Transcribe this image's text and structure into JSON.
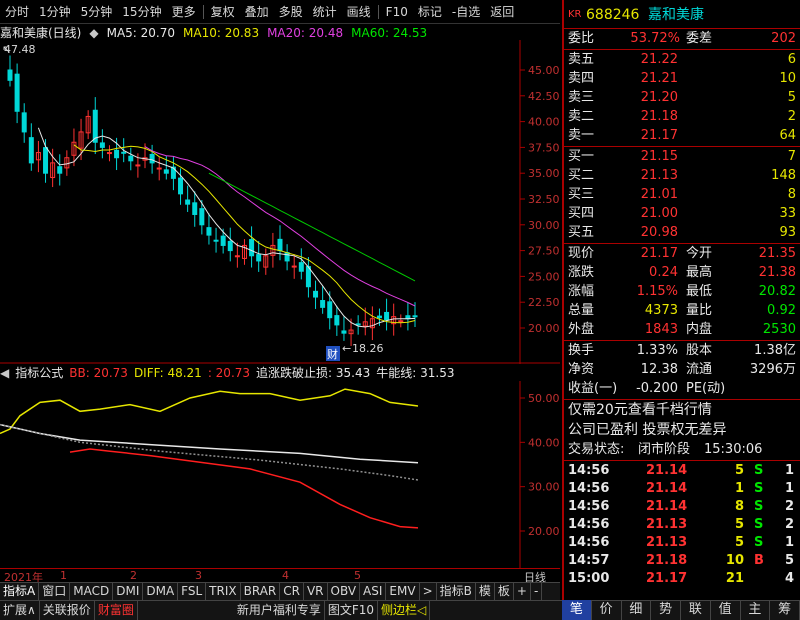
{
  "toolbar": {
    "items": [
      "分时",
      "1分钟",
      "5分钟",
      "15分钟",
      "更多",
      "复权",
      "叠加",
      "多股",
      "统计",
      "画线",
      "F10",
      "标记",
      "-自选",
      "返回"
    ]
  },
  "chart_header": {
    "stock_name": "嘉和美康(日线)",
    "ma5": "MA5: 20.70",
    "ma10": "MA10: 20.83",
    "ma20": "MA20: 20.48",
    "ma60": "MA60: 24.53",
    "high_label": "47.48",
    "low_label": "18.26",
    "cai_label": "财"
  },
  "price_axis": [
    "45.00",
    "42.50",
    "40.00",
    "37.50",
    "35.00",
    "32.50",
    "30.00",
    "27.50",
    "25.00",
    "22.50",
    "20.00"
  ],
  "indicator_header": {
    "name": "指标公式",
    "bb": "BB: 20.73",
    "diff": "DIFF: 48.21",
    "third": ": 20.73",
    "stop": "追涨跌破止损: 35.43",
    "bull": "牛能线: 31.53"
  },
  "indicator_axis": [
    "50.00",
    "40.00",
    "30.00",
    "20.00"
  ],
  "date_axis": {
    "year": "2021年",
    "months": [
      "1",
      "2",
      "3",
      "4",
      "5"
    ],
    "right_label": "日线"
  },
  "tabs": [
    "指标A",
    "窗口",
    "MACD",
    "DMI",
    "DMA",
    "FSL",
    "TRIX",
    "BRAR",
    "CR",
    "VR",
    "OBV",
    "ASI",
    "EMV",
    ">",
    "指标B",
    "模",
    "板",
    "+",
    "-"
  ],
  "bottom_bar": [
    "扩展∧",
    "关联报价",
    "财富圈",
    "新用户福利专享",
    "图文F10",
    "侧边栏◁"
  ],
  "stock": {
    "code_prefix": "KR",
    "code": "688246",
    "name": "嘉和美康"
  },
  "order_book": {
    "weibi_label": "委比",
    "weibi": "53.72%",
    "weicha_label": "委差",
    "weicha": "202",
    "asks": [
      {
        "label": "卖五",
        "price": "21.22",
        "vol": "6"
      },
      {
        "label": "卖四",
        "price": "21.21",
        "vol": "10"
      },
      {
        "label": "卖三",
        "price": "21.20",
        "vol": "5"
      },
      {
        "label": "卖二",
        "price": "21.18",
        "vol": "2"
      },
      {
        "label": "卖一",
        "price": "21.17",
        "vol": "64"
      }
    ],
    "bids": [
      {
        "label": "买一",
        "price": "21.15",
        "vol": "7"
      },
      {
        "label": "买二",
        "price": "21.13",
        "vol": "148"
      },
      {
        "label": "买三",
        "price": "21.01",
        "vol": "8"
      },
      {
        "label": "买四",
        "price": "21.00",
        "vol": "33"
      },
      {
        "label": "买五",
        "price": "20.98",
        "vol": "93"
      }
    ]
  },
  "stats": [
    {
      "l1": "现价",
      "v1": "21.17",
      "c1": "red",
      "l2": "今开",
      "v2": "21.35",
      "c2": "red"
    },
    {
      "l1": "涨跌",
      "v1": "0.24",
      "c1": "red",
      "l2": "最高",
      "v2": "21.38",
      "c2": "red"
    },
    {
      "l1": "涨幅",
      "v1": "1.15%",
      "c1": "red",
      "l2": "最低",
      "v2": "20.82",
      "c2": "green"
    },
    {
      "l1": "总量",
      "v1": "4373",
      "c1": "yellow",
      "l2": "量比",
      "v2": "0.92",
      "c2": "green"
    },
    {
      "l1": "外盘",
      "v1": "1843",
      "c1": "red",
      "l2": "内盘",
      "v2": "2530",
      "c2": "green"
    }
  ],
  "stats2": [
    {
      "l1": "换手",
      "v1": "1.33%",
      "l2": "股本",
      "v2": "1.38亿"
    },
    {
      "l1": "净资",
      "v1": "12.38",
      "l2": "流通",
      "v2": "3296万"
    },
    {
      "l1": "收益(一)",
      "v1": "-0.200",
      "l2": "PE(动)",
      "v2": ""
    }
  ],
  "notices": {
    "line1": "仅需20元查看千档行情",
    "line2": "公司已盈利 投票权无差异",
    "status_label": "交易状态:",
    "status_value": "闭市阶段",
    "status_time": "15:30:06"
  },
  "ticks": [
    {
      "time": "14:56",
      "price": "21.14",
      "vol": "5",
      "side": "S",
      "n": "1"
    },
    {
      "time": "14:56",
      "price": "21.14",
      "vol": "1",
      "side": "S",
      "n": "1"
    },
    {
      "time": "14:56",
      "price": "21.14",
      "vol": "8",
      "side": "S",
      "n": "2"
    },
    {
      "time": "14:56",
      "price": "21.13",
      "vol": "5",
      "side": "S",
      "n": "2"
    },
    {
      "time": "14:56",
      "price": "21.13",
      "vol": "5",
      "side": "S",
      "n": "1"
    },
    {
      "time": "14:57",
      "price": "21.18",
      "vol": "10",
      "side": "B",
      "n": "5"
    },
    {
      "time": "15:00",
      "price": "21.17",
      "vol": "21",
      "side": "",
      "n": "4"
    }
  ],
  "quote_tabs": [
    "笔",
    "价",
    "细",
    "势",
    "联",
    "值",
    "主",
    "筹"
  ],
  "colors": {
    "accent_red": "#ff3232",
    "green": "#00e600",
    "yellow": "#e6e600",
    "border": "#aa0000",
    "cyan": "#00d8d8"
  }
}
